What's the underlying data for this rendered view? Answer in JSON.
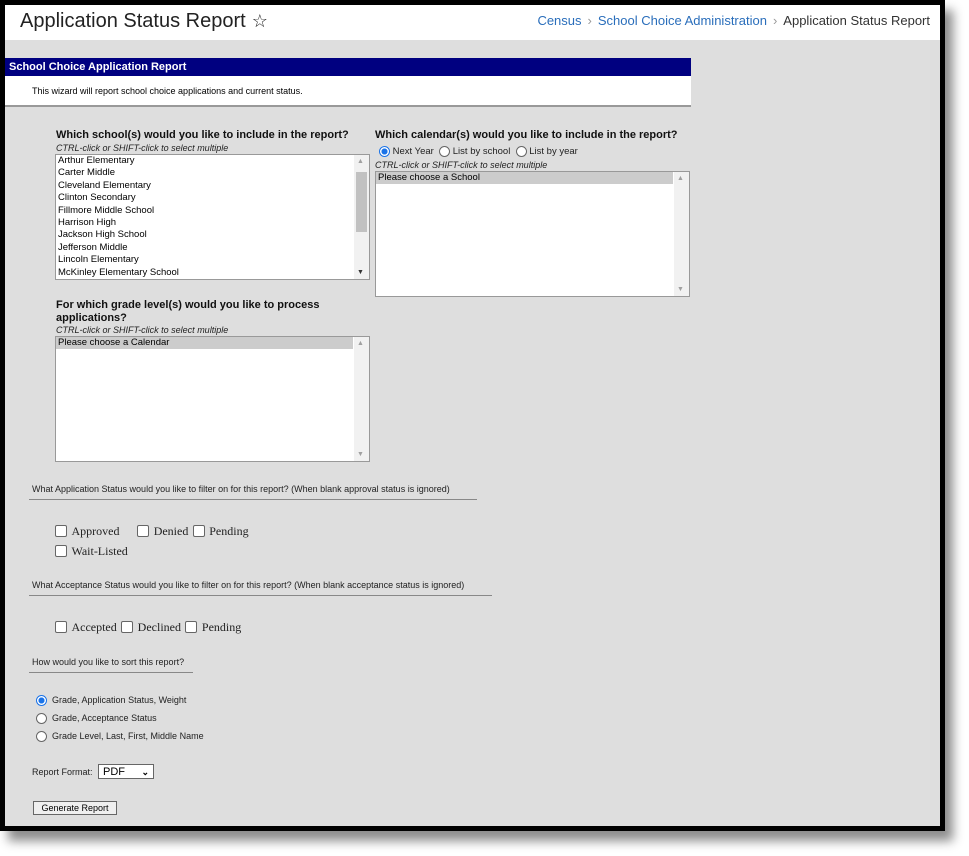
{
  "header": {
    "title": "Application Status Report",
    "breadcrumb": [
      "Census",
      "School Choice Administration",
      "Application Status Report"
    ]
  },
  "banner": {
    "title": "School Choice Application Report",
    "description": "This wizard will report school choice applications and current status."
  },
  "schools": {
    "question": "Which school(s) would you like to include in the report?",
    "hint": "CTRL-click or SHIFT-click to select multiple",
    "items": [
      "Arthur Elementary",
      "Carter Middle",
      "Cleveland Elementary",
      "Clinton Secondary",
      "Fillmore Middle School",
      "Harrison High",
      "Jackson High School",
      "Jefferson Middle",
      "Lincoln Elementary",
      "McKinley Elementary School"
    ]
  },
  "calendars": {
    "question": "Which calendar(s) would you like to include in the report?",
    "options": [
      "Next Year",
      "List by school",
      "List by year"
    ],
    "selected": "Next Year",
    "hint": "CTRL-click or SHIFT-click to select multiple",
    "placeholder": "Please choose a School"
  },
  "grades": {
    "question_line1": "For which grade level(s) would you like to process",
    "question_line2": "applications?",
    "hint": "CTRL-click or SHIFT-click to select multiple",
    "placeholder": "Please choose a Calendar"
  },
  "application_status": {
    "question": "What Application Status would you like to filter on for this report? (When blank approval status is ignored)",
    "options": [
      "Approved",
      "Denied",
      "Pending",
      "Wait-Listed"
    ]
  },
  "acceptance_status": {
    "question": "What Acceptance Status would you like to filter on for this report? (When blank acceptance status is ignored)",
    "options": [
      "Accepted",
      "Declined",
      "Pending"
    ]
  },
  "sort": {
    "question": "How would you like to sort this report?",
    "options": [
      "Grade, Application Status, Weight",
      "Grade, Acceptance Status",
      "Grade Level, Last, First, Middle Name"
    ],
    "selected": "Grade, Application Status, Weight"
  },
  "format": {
    "label": "Report Format:",
    "value": "PDF"
  },
  "generate_label": "Generate Report"
}
